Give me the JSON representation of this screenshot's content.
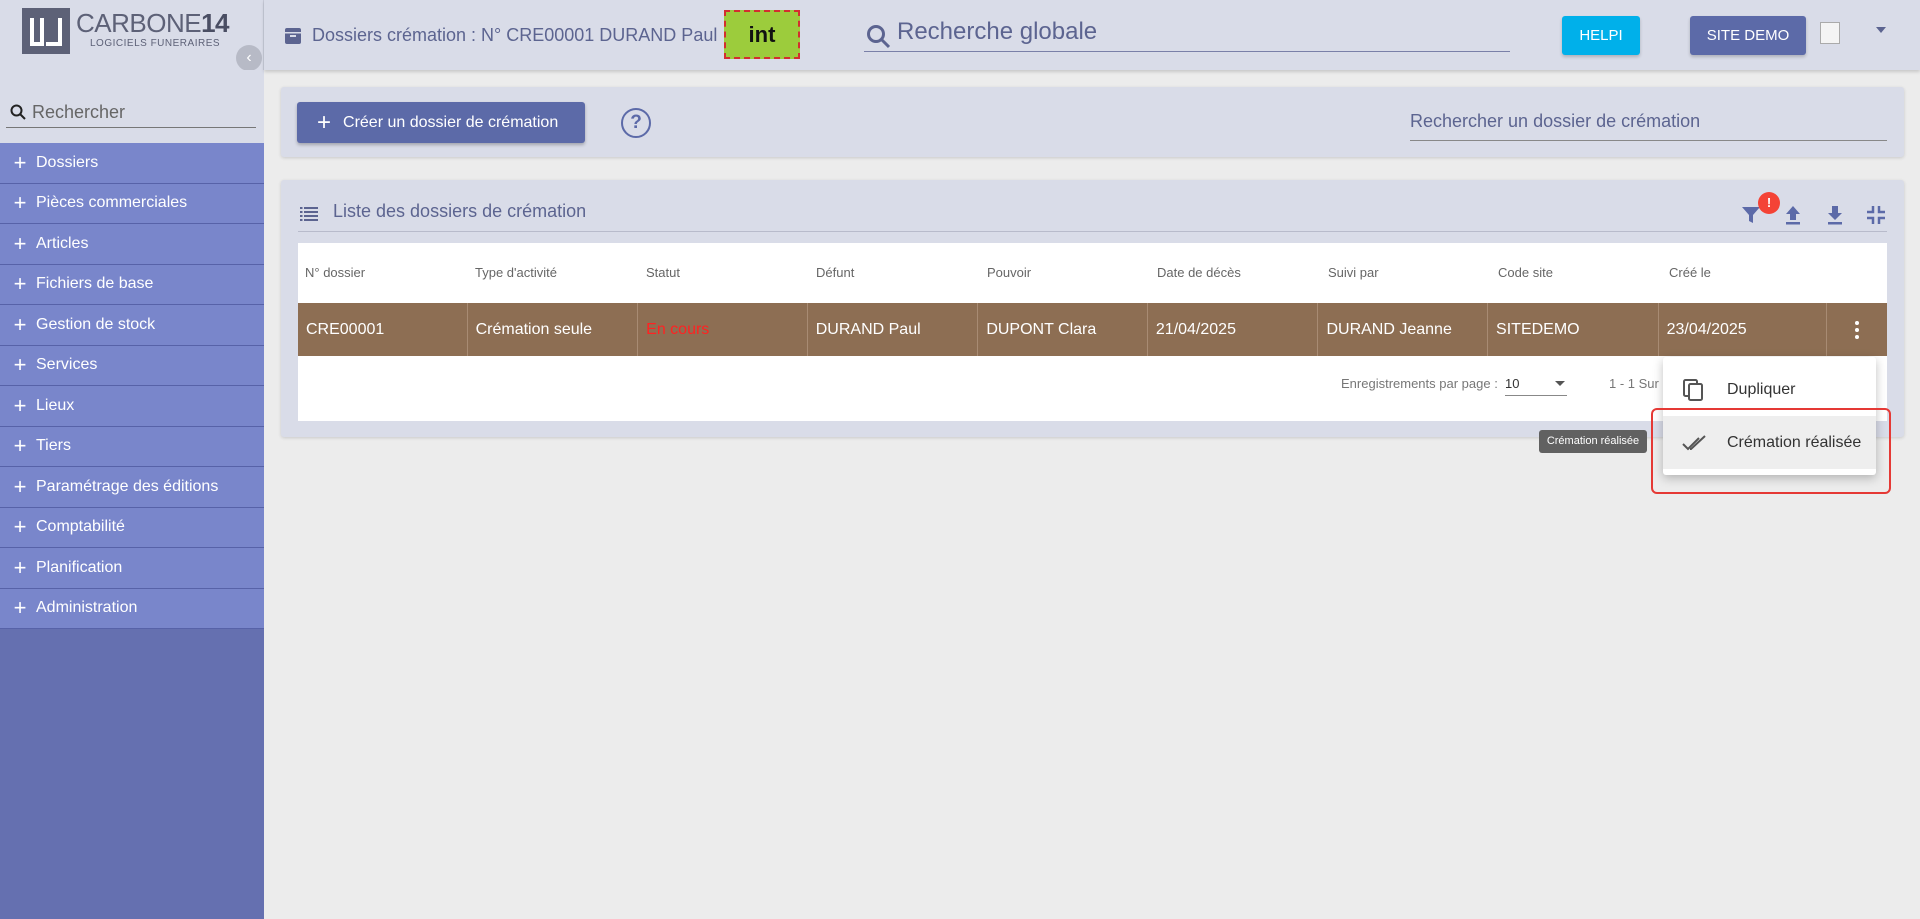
{
  "brand": {
    "name_light": "CARBONE",
    "name_bold": "14",
    "tagline": "LOGICIELS FUNERAIRES"
  },
  "sidebar": {
    "search_placeholder": "Rechercher",
    "items": [
      {
        "label": "Dossiers"
      },
      {
        "label": "Pièces commerciales"
      },
      {
        "label": "Articles"
      },
      {
        "label": "Fichiers de base"
      },
      {
        "label": "Gestion de stock"
      },
      {
        "label": "Services"
      },
      {
        "label": "Lieux"
      },
      {
        "label": "Tiers"
      },
      {
        "label": "Paramétrage des éditions"
      },
      {
        "label": "Comptabilité"
      },
      {
        "label": "Planification"
      },
      {
        "label": "Administration"
      }
    ]
  },
  "header": {
    "title": "Dossiers crémation : N° CRE00001 DURAND Paul",
    "env_badge": "int",
    "global_search_placeholder": "Recherche globale",
    "helpi_label": "HELPI",
    "site_label": "SITE DEMO"
  },
  "actions": {
    "create_label": "Créer un dossier de crémation",
    "help_glyph": "?",
    "search_placeholder": "Rechercher un dossier de crémation"
  },
  "list": {
    "title": "Liste des dossiers de crémation",
    "filter_badge": "!",
    "columns": [
      "N° dossier",
      "Type d'activité",
      "Statut",
      "Défunt",
      "Pouvoir",
      "Date de décès",
      "Suivi par",
      "Code site",
      "Créé le"
    ],
    "rows": [
      [
        "CRE00001",
        "Crémation seule",
        "En cours",
        "DURAND Paul",
        "DUPONT Clara",
        "21/04/2025",
        "DURAND Jeanne",
        "SITEDEMO",
        "23/04/2025"
      ]
    ],
    "per_page_label": "Enregistrements par page :",
    "per_page_value": "10",
    "range_text": "1 - 1 Sur 1"
  },
  "context_menu": {
    "items": [
      {
        "label": "Dupliquer",
        "icon": "copy-icon"
      },
      {
        "label": "Crémation réalisée",
        "icon": "done-all-icon"
      }
    ],
    "tooltip": "Crémation réalisée"
  },
  "colors": {
    "sidebar": "#6570b0",
    "menu_item": "#7986cb",
    "primary": "#5c6aa8",
    "helpi": "#00b0ea",
    "row_selected": "#8d6e53",
    "status_red": "#ff2222",
    "env_badge": "#9ccc3c"
  }
}
